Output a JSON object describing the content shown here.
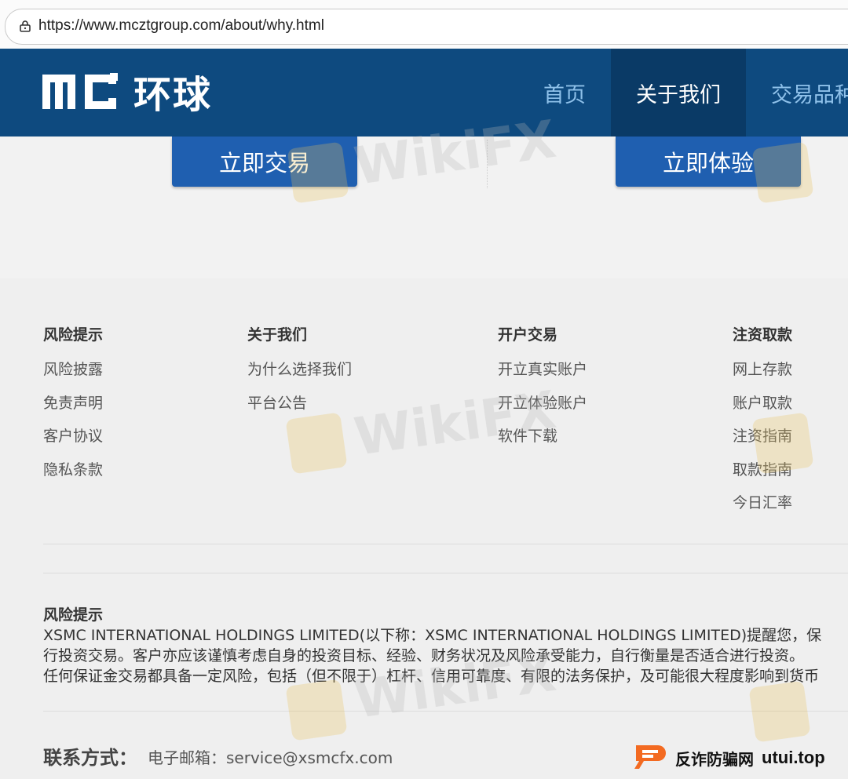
{
  "browser": {
    "url": "https://www.mcztgroup.com/about/why.html"
  },
  "header": {
    "logo_text": "环球",
    "nav": [
      "首页",
      "关于我们",
      "交易品种"
    ]
  },
  "cta": {
    "trade": "立即交易",
    "demo": "立即体验"
  },
  "footer": {
    "columns": [
      {
        "title": "风险提示",
        "links": [
          "风险披露",
          "免责声明",
          "客户协议",
          "隐私条款"
        ]
      },
      {
        "title": "关于我们",
        "links": [
          "为什么选择我们",
          "平台公告"
        ]
      },
      {
        "title": "开户交易",
        "links": [
          "开立真实账户",
          "开立体验账户",
          "软件下载"
        ]
      },
      {
        "title": "注资取款",
        "links": [
          "网上存款",
          "账户取款",
          "注资指南",
          "取款指南",
          "今日汇率"
        ]
      }
    ],
    "risk": {
      "title": "风险提示",
      "lines": [
        "XSMC INTERNATIONAL HOLDINGS LIMITED(以下称：XSMC INTERNATIONAL HOLDINGS LIMITED)提醒您，保",
        "行投资交易。客户亦应该谨慎考虑自身的投资目标、经验、财务状况及风险承受能力，自行衡量是否适合进行投资。",
        "任何保证金交易都具备一定风险，包括（但不限于）杠杆、信用可靠度、有限的法务保护，及可能很大程度影响到货币"
      ]
    },
    "contact": {
      "label": "联系方式：",
      "email": "电子邮箱：service@xsmcfx.com"
    }
  },
  "watermark": {
    "text": "WikiFX"
  },
  "badge": {
    "text": "反诈防骗网",
    "domain": "utui.top"
  },
  "colors": {
    "header": "#0e4a7f",
    "nav_active": "#0a3a66",
    "button": "#1f5fb0",
    "nav_text": "#8fc1ea"
  }
}
